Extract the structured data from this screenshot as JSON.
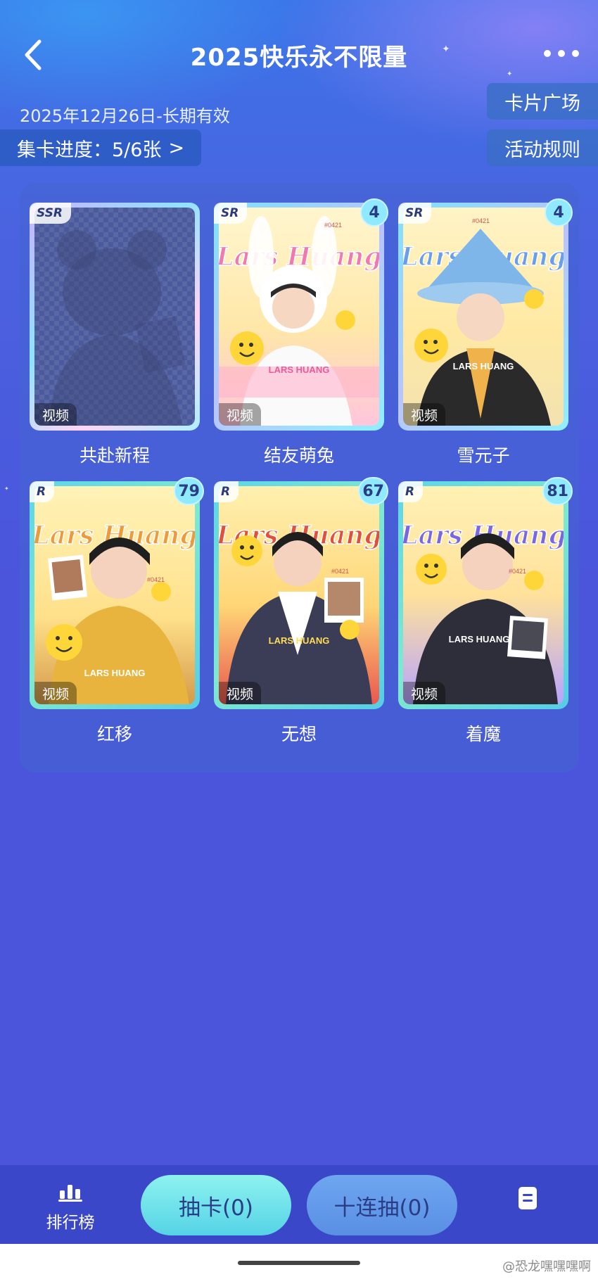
{
  "header": {
    "title": "2025快乐永不限量",
    "back_icon": "back-chevron-icon",
    "more_icon": "more-dots-icon"
  },
  "event": {
    "date_text": "2025年12月26日-长期有效",
    "progress_label": "集卡进度：5/6张",
    "progress_chevron": ">",
    "plaza_label": "卡片广场",
    "rules_label": "活动规则"
  },
  "cards": [
    {
      "name": "共赴新程",
      "rarity": "SSR",
      "count": "",
      "tag": "视频",
      "locked": true
    },
    {
      "name": "结友萌兔",
      "rarity": "SR",
      "count": "4",
      "tag": "视频",
      "locked": false
    },
    {
      "name": "雪元子",
      "rarity": "SR",
      "count": "4",
      "tag": "视频",
      "locked": false
    },
    {
      "name": "红移",
      "rarity": "R",
      "count": "79",
      "tag": "视频",
      "locked": false
    },
    {
      "name": "无想",
      "rarity": "R",
      "count": "67",
      "tag": "视频",
      "locked": false
    },
    {
      "name": "着魔",
      "rarity": "R",
      "count": "81",
      "tag": "视频",
      "locked": false
    }
  ],
  "card_art_text": {
    "logo": "Lars Huang",
    "nameplate": "LARS HUANG",
    "code": "#0421"
  },
  "bottom": {
    "rank_label": "排行榜",
    "rank_icon": "bar-chart-icon",
    "draw_label": "抽卡(0)",
    "draw10_label": "十连抽(0)",
    "doc_icon": "document-icon"
  },
  "watermark": "@恐龙嘿嘿嘿啊",
  "colors": {
    "background": "#4a55dc",
    "bottom_bar": "#3b47c9",
    "draw_button": "#8df2ef",
    "draw10_button": "#6ea6f0",
    "badge": "#8fe9ff"
  }
}
